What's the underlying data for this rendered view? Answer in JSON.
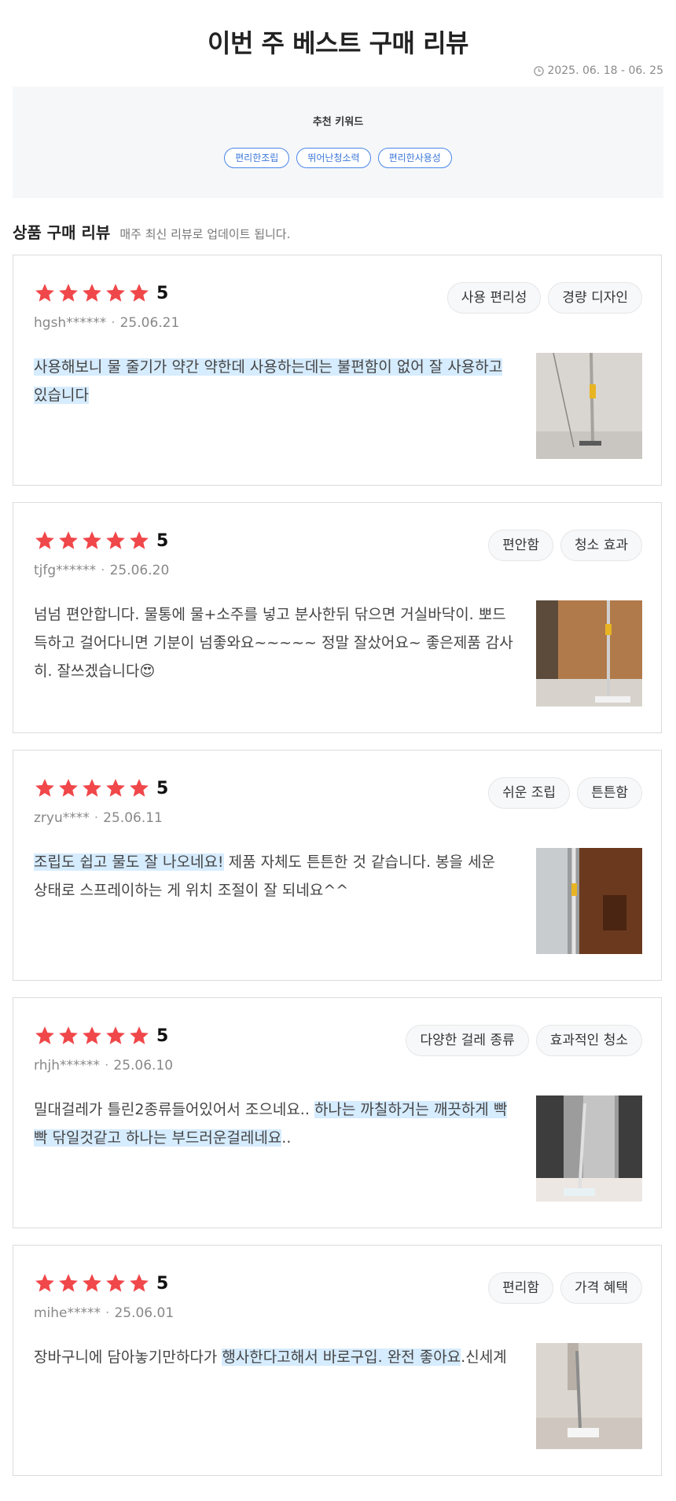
{
  "header": {
    "title": "이번 주 베스트 구매 리뷰",
    "period": "2025. 06. 18 - 06. 25"
  },
  "keywords": {
    "title": "추천 키워드",
    "chips": [
      "편리한조립",
      "뛰어난청소력",
      "편리한사용성"
    ]
  },
  "section": {
    "title": "상품 구매 리뷰",
    "subtitle": "매주 최신 리뷰로 업데이트 됩니다."
  },
  "colors": {
    "star": "#f0474a",
    "highlight": "#d6ecff",
    "chip_border": "#4a86e8"
  },
  "reviews": [
    {
      "rating": "5",
      "stars": 5,
      "user": "hgsh******",
      "date": "25.06.21",
      "tags": [
        "사용 편리성",
        "경량 디자인"
      ],
      "text_parts": [
        {
          "t": "사용해보니 물 줄기가 약간 약한데 사용하는데는 불편함이 없어 잘 사용하고 있습니다",
          "hl": true
        }
      ],
      "image": "mop-photo-1"
    },
    {
      "rating": "5",
      "stars": 5,
      "user": "tjfg******",
      "date": "25.06.20",
      "tags": [
        "편안함",
        "청소 효과"
      ],
      "text_parts": [
        {
          "t": "넘넘 편안합니다. 물통에 물+소주를 넣고 분사한뒤 닦으면 거실바닥이. 뽀드득하고 걸어다니면 기분이 넘좋와요~~~~~ 정말 잘샀어요~ 좋은제품 감사히. 잘쓰겠습니다😍",
          "hl": false
        }
      ],
      "image": "mop-photo-2"
    },
    {
      "rating": "5",
      "stars": 5,
      "user": "zryu****",
      "date": "25.06.11",
      "tags": [
        "쉬운 조립",
        "튼튼함"
      ],
      "text_parts": [
        {
          "t": "조립도 쉽고 물도 잘 나오네요!",
          "hl": true
        },
        {
          "t": " 제품 자체도 튼튼한 것 같습니다. 봉을 세운 상태로 스프레이하는 게 위치 조절이 잘 되네요^^",
          "hl": false
        }
      ],
      "image": "mop-photo-3"
    },
    {
      "rating": "5",
      "stars": 5,
      "user": "rhjh******",
      "date": "25.06.10",
      "tags": [
        "다양한 걸레 종류",
        "효과적인 청소"
      ],
      "text_parts": [
        {
          "t": "밀대걸레가 틀린2종류들어있어서 조으네요.. ",
          "hl": false
        },
        {
          "t": "하나는 까칠하거는 깨끗하게 빡빡 닦일것같고 하나는 부드러운걸레네요",
          "hl": true
        },
        {
          "t": "..",
          "hl": false
        }
      ],
      "image": "mop-photo-4"
    },
    {
      "rating": "5",
      "stars": 5,
      "user": "mihe*****",
      "date": "25.06.01",
      "tags": [
        "편리함",
        "가격 혜택"
      ],
      "text_parts": [
        {
          "t": "장바구니에 담아놓기만하다가 ",
          "hl": false
        },
        {
          "t": "행사한다고해서 바로구입. 완전 좋아요",
          "hl": true
        },
        {
          "t": ".신세계",
          "hl": false
        }
      ],
      "image": "mop-photo-5"
    }
  ]
}
